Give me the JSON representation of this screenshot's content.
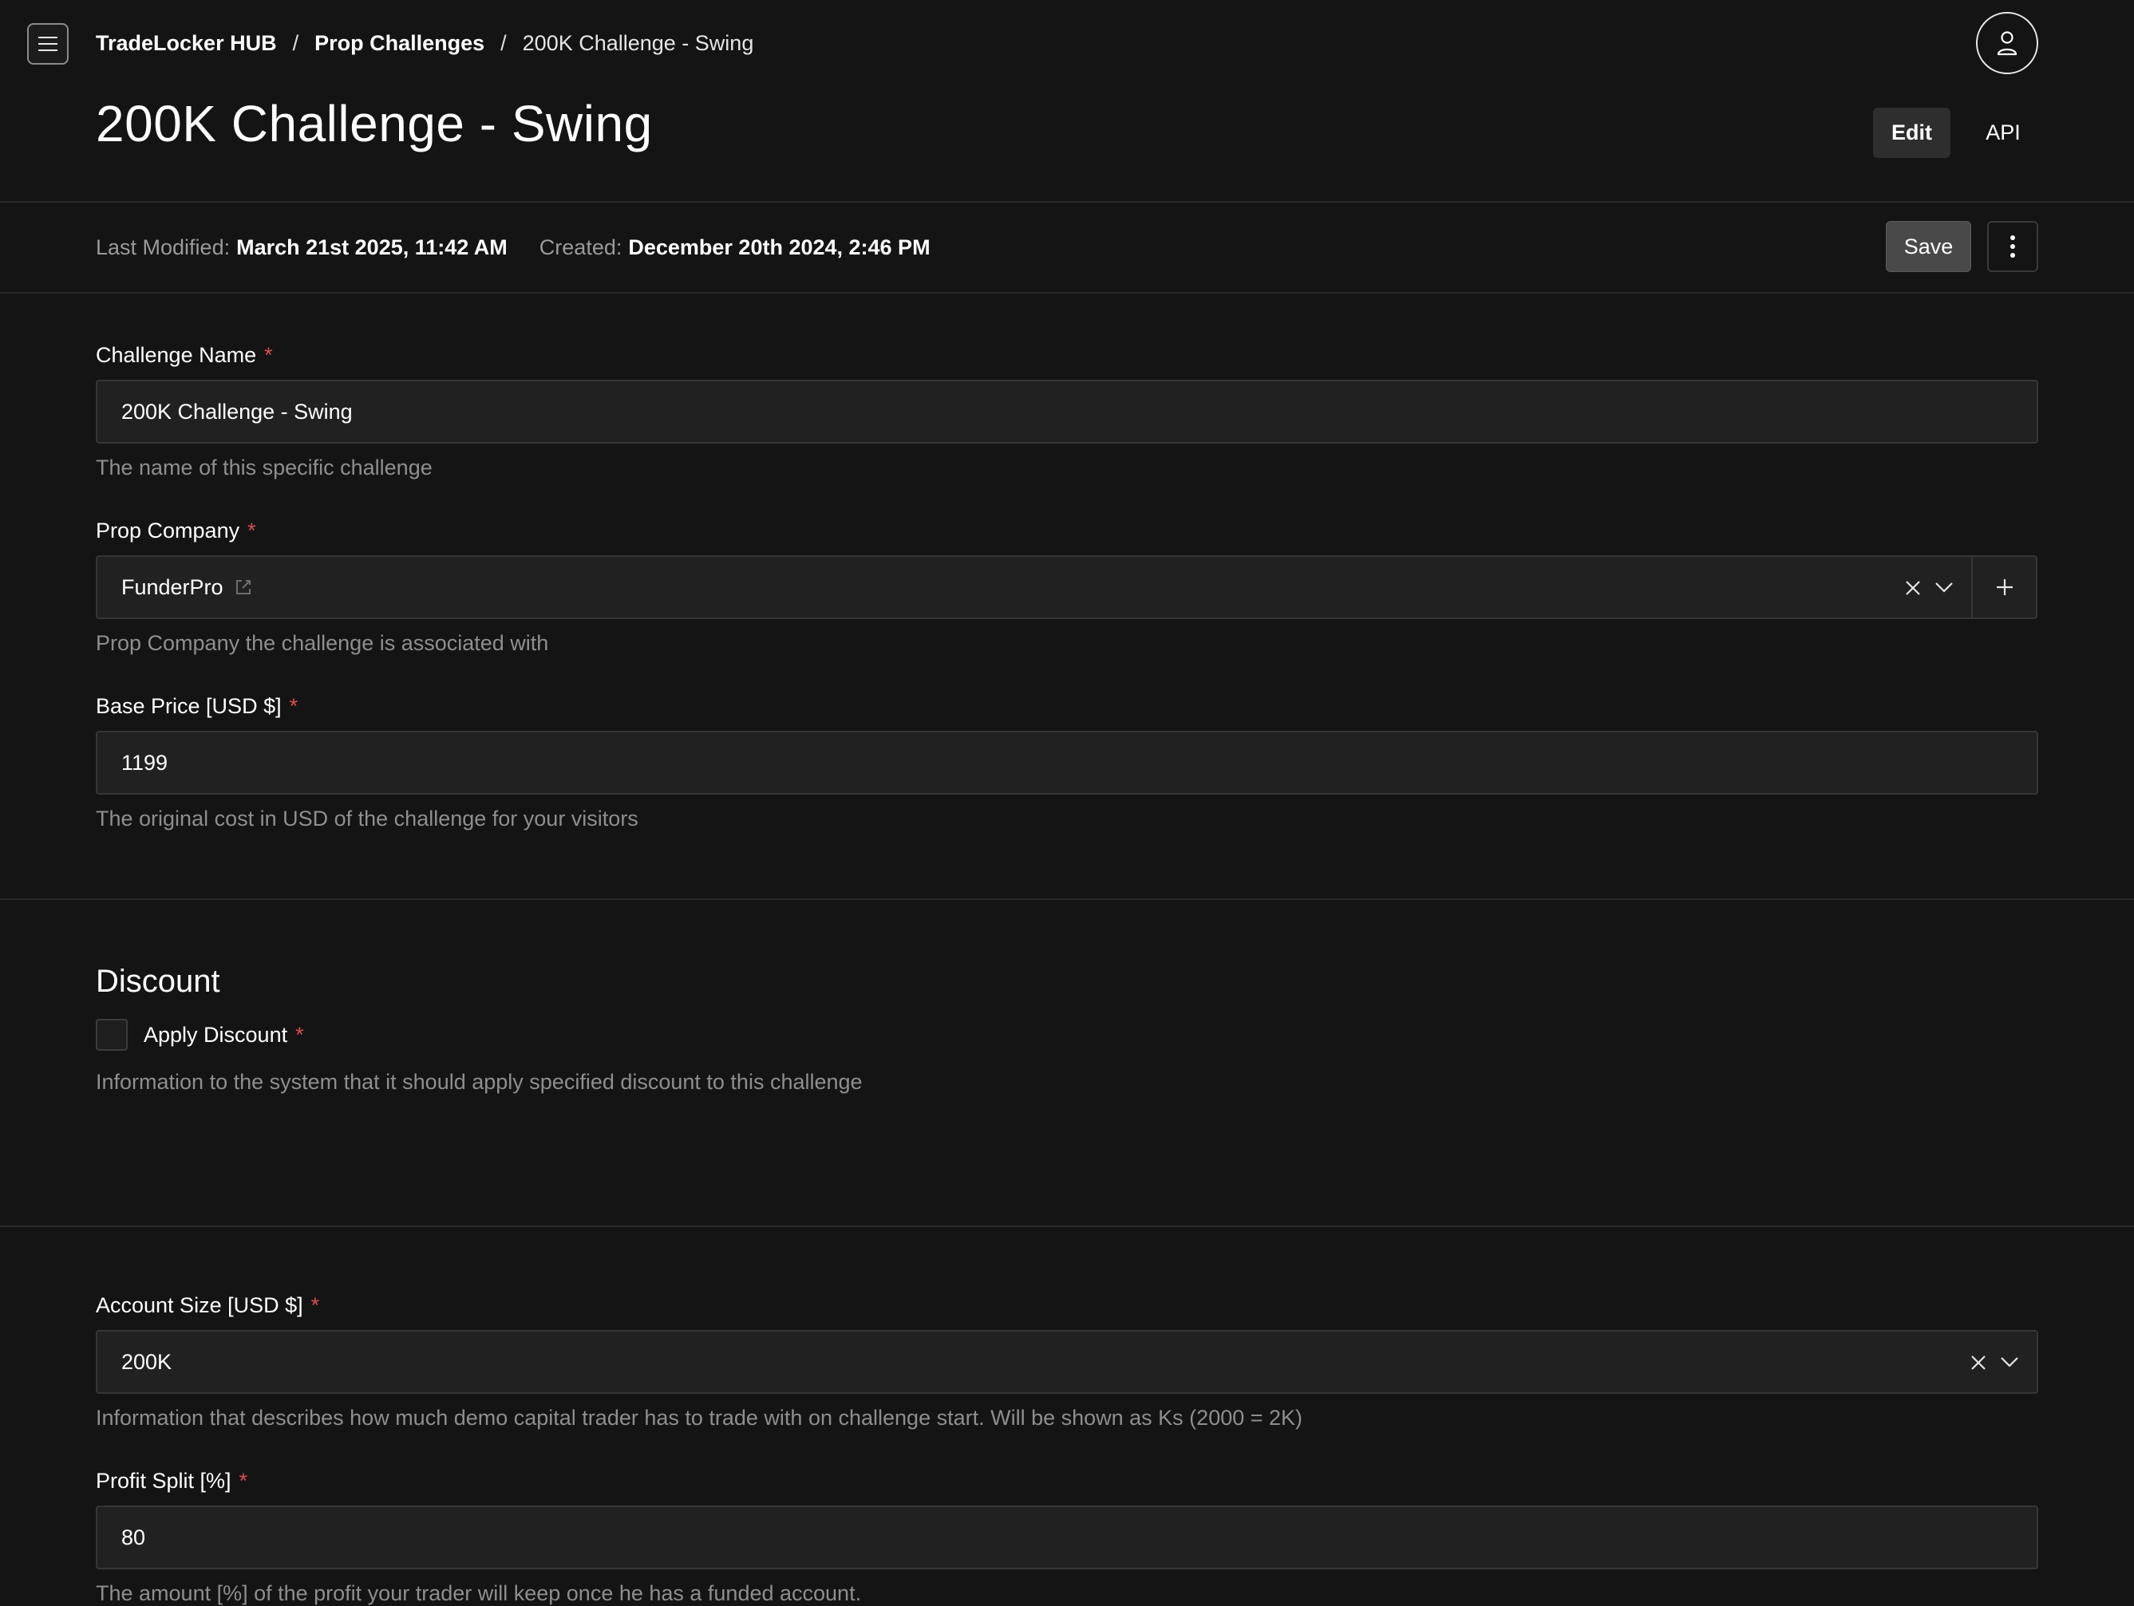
{
  "header": {
    "breadcrumb": {
      "root": "TradeLocker HUB",
      "section": "Prop Challenges",
      "current": "200K Challenge - Swing",
      "separator": "/"
    },
    "title": "200K Challenge - Swing",
    "tabs": [
      {
        "label": "Edit",
        "active": true
      },
      {
        "label": "API",
        "active": false
      }
    ]
  },
  "meta": {
    "last_modified_label": "Last Modified:",
    "last_modified_value": "March 21st 2025, 11:42 AM",
    "created_label": "Created:",
    "created_value": "December 20th 2024, 2:46 PM"
  },
  "toolbar": {
    "save_label": "Save"
  },
  "form": {
    "challenge_name": {
      "label": "Challenge Name",
      "required": "*",
      "value": "200K Challenge - Swing",
      "help": "The name of this specific challenge"
    },
    "prop_company": {
      "label": "Prop Company",
      "required": "*",
      "value": "FunderPro",
      "help": "Prop Company the challenge is associated with"
    },
    "base_price": {
      "label": "Base Price [USD $]",
      "required": "*",
      "value": "1199",
      "help": "The original cost in USD of the challenge for your visitors"
    },
    "discount": {
      "section_title": "Discount",
      "checkbox_label": "Apply Discount",
      "required": "*",
      "checked": false,
      "help": "Information to the system that it should apply specified discount to this challenge"
    },
    "account_size": {
      "label": "Account Size [USD $]",
      "required": "*",
      "value": "200K",
      "help": "Information that describes how much demo capital trader has to trade with on challenge start. Will be shown as Ks (2000 = 2K)"
    },
    "profit_split": {
      "label": "Profit Split [%]",
      "required": "*",
      "value": "80",
      "help": "The amount [%] of the profit your trader will keep once he has a funded account."
    }
  },
  "colors": {
    "background": "#141414",
    "field_bg": "#212121",
    "required": "#e04b4b",
    "muted_text": "#8e8e8e"
  },
  "icons": [
    "menu-icon",
    "user-icon",
    "more-vertical-icon",
    "external-edit-icon",
    "clear-icon",
    "chevron-down-icon",
    "plus-icon"
  ]
}
